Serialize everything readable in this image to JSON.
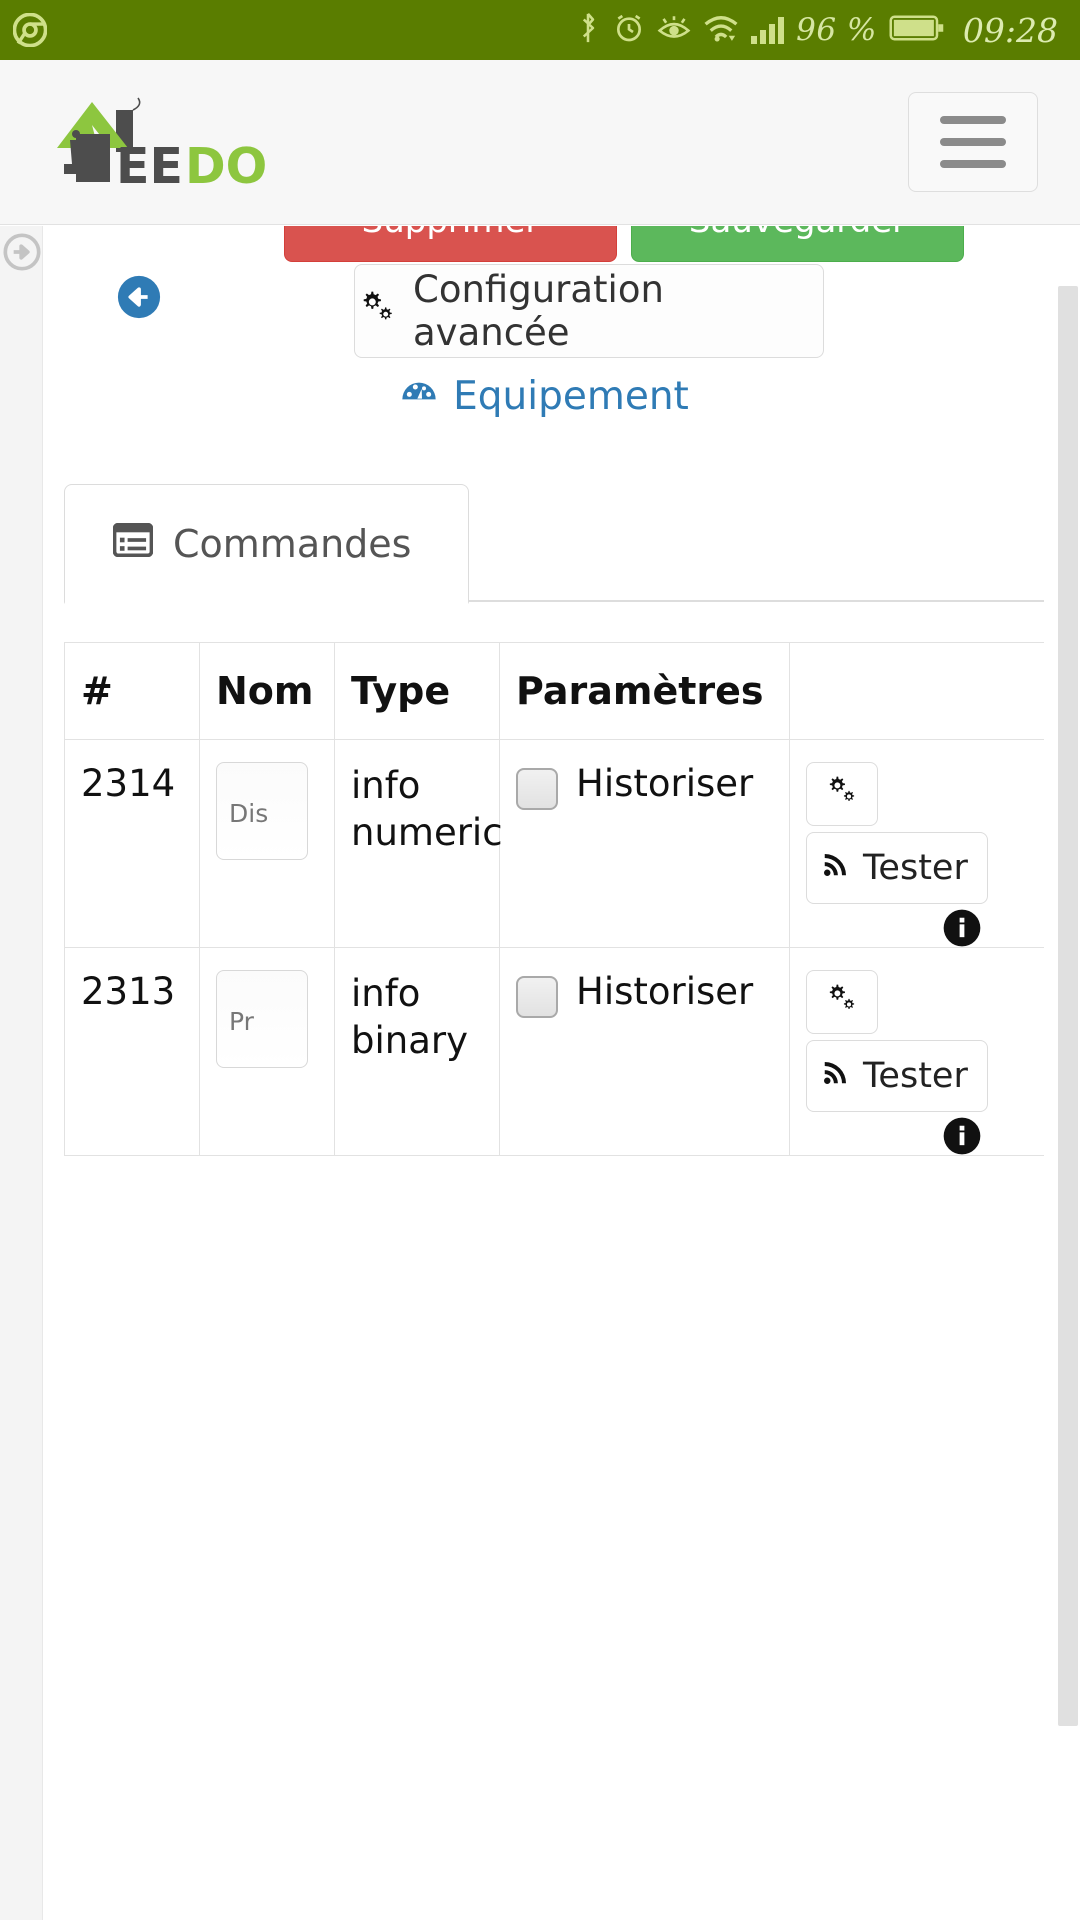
{
  "statusbar": {
    "browser_icon": "chrome-icon",
    "icons": [
      "bluetooth-icon",
      "alarm-clock-icon",
      "eye-icon",
      "wifi-icon",
      "signal-bars-icon"
    ],
    "battery_percent": "96 %",
    "battery_icon": "battery-icon",
    "time": "09:28"
  },
  "header": {
    "logo_text_dark": "EE",
    "logo_text_green": "DOM",
    "logo_icon": "jeedom-house-logo",
    "menu_button_label": "",
    "menu_icon": "hamburger-menu-icon",
    "brand_green": "#8dc63f",
    "brand_dark": "#4d4d4d"
  },
  "sidebar": {
    "toggle_icon": "arrow-circle-right-icon"
  },
  "actions": {
    "danger_label": "Supprimer",
    "success_label": "Sauvegarder",
    "danger_color": "#d9534f",
    "success_color": "#5cb85c",
    "config_label": "Configuration avancée",
    "config_icon": "cogs-icon",
    "back_icon": "arrow-circle-left-icon"
  },
  "equipement": {
    "title": "Equipement",
    "icon": "tachometer-icon",
    "link_color": "#2f7bb5"
  },
  "tabs": [
    {
      "label": "Commandes",
      "icon": "list-alt-icon",
      "active": true
    }
  ],
  "table": {
    "columns": [
      "#",
      "Nom",
      "Type",
      "Paramètres",
      ""
    ],
    "rows": [
      {
        "id": "2314",
        "nom_value": "Dis",
        "nom_placeholder": "Nom",
        "type": "info numeric",
        "historiser_label": "Historiser",
        "historiser_checked": false,
        "config_icon": "cogs-icon",
        "test_label": "Tester",
        "test_icon": "rss-icon",
        "extra_icon": "info-circle-icon"
      },
      {
        "id": "2313",
        "nom_value": "Pr",
        "nom_placeholder": "Nom",
        "type": "info binary",
        "historiser_label": "Historiser",
        "historiser_checked": false,
        "config_icon": "cogs-icon",
        "test_label": "Tester",
        "test_icon": "rss-icon",
        "extra_icon": "info-circle-icon"
      }
    ]
  },
  "scrollbar": {
    "name": "vertical-scrollbar"
  }
}
